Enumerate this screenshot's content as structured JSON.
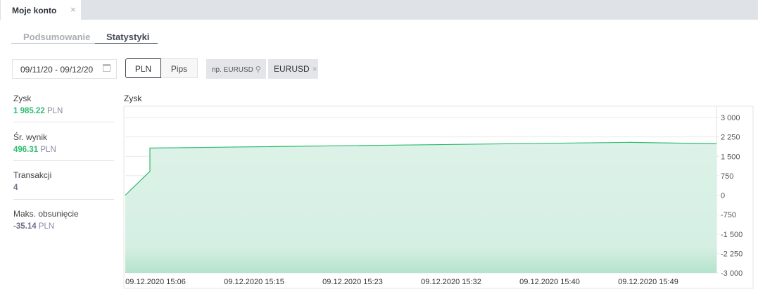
{
  "tab": {
    "title": "Moje konto",
    "close": "×"
  },
  "subtabs": [
    {
      "label": "Podsumowanie",
      "active": false
    },
    {
      "label": "Statystyki",
      "active": true
    }
  ],
  "filters": {
    "date_range": "09/11/20 - 09/12/20",
    "units": [
      "PLN",
      "Pips"
    ],
    "selected_unit": "PLN",
    "search_placeholder": "np. EURUSD",
    "chip": "EURUSD",
    "chip_close": "×"
  },
  "stats": [
    {
      "label": "Zysk",
      "value": "1 985.22",
      "unit": "PLN",
      "color": "#2dbd6e"
    },
    {
      "label": "Śr. wynik",
      "value": "496.31",
      "unit": "PLN",
      "color": "#2dbd6e"
    },
    {
      "label": "Transakcji",
      "value": "4",
      "unit": "",
      "color": "#6e6e8e"
    },
    {
      "label": "Maks. obsunięcie",
      "value": "-35.14",
      "unit": "PLN",
      "color": "#6e6e8e"
    }
  ],
  "chart_data": {
    "type": "area",
    "title": "Zysk",
    "ylim": [
      -3000,
      3000
    ],
    "yticks": [
      "3 000",
      "2 250",
      "1 500",
      "750",
      "0",
      "-750",
      "-1 500",
      "-2 250",
      "-3 000"
    ],
    "ytick_values": [
      3000,
      2250,
      1500,
      750,
      0,
      -750,
      -1500,
      -2250,
      -3000
    ],
    "xticks": [
      "09.12.2020 15:06",
      "09.12.2020 15:15",
      "09.12.2020 15:23",
      "09.12.2020 15:32",
      "09.12.2020 15:40",
      "09.12.2020 15:49"
    ],
    "points": [
      {
        "x": "15:04",
        "y": 0
      },
      {
        "x": "15:06",
        "y": 920
      },
      {
        "x": "15:06",
        "y": 1820
      },
      {
        "x": "15:48",
        "y": 2040
      },
      {
        "x": "15:55",
        "y": 1985
      }
    ],
    "line_color": "#2dbd6e",
    "fill_color": "#d8f0e5",
    "grid": true,
    "y_axis": "right"
  }
}
